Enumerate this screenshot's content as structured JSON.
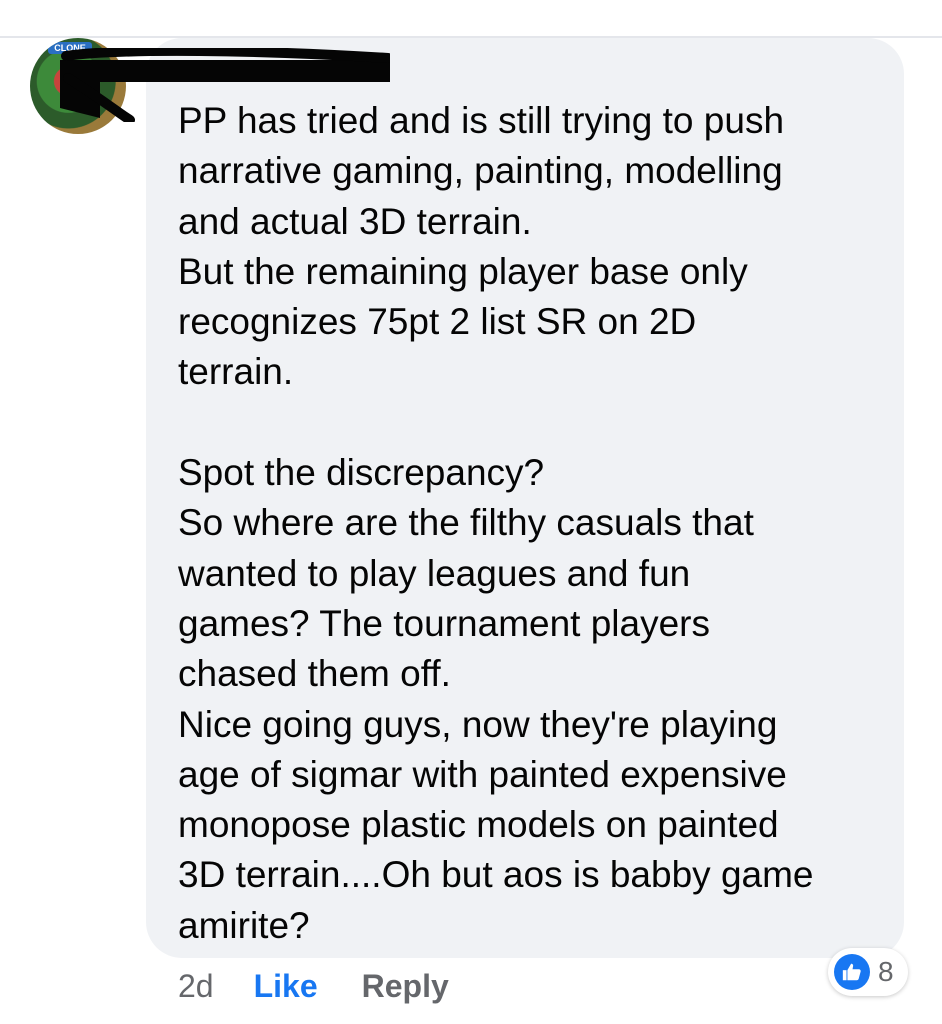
{
  "comment": {
    "text": "PP has tried and is still trying to push\nnarrative gaming, painting, modelling\nand actual 3D terrain.\nBut the remaining player base only\nrecognizes 75pt 2 list SR on 2D\nterrain.\n\nSpot the discrepancy?\nSo where are the filthy casuals that\nwanted to play leagues and fun\ngames? The tournament players\nchased them off.\nNice going guys, now they're playing\nage of sigmar with painted expensive\nmonopose plastic models on painted\n3D terrain....Oh but aos is babby game\namirite?"
  },
  "actions": {
    "time": "2d",
    "like_label": "Like",
    "reply_label": "Reply"
  },
  "reactions": {
    "icon": "thumbs-up-icon",
    "count": "8"
  },
  "colors": {
    "bubble": "#f0f2f5",
    "accent": "#1877f2",
    "secondary_text": "#65676b",
    "primary_text": "#050505"
  }
}
